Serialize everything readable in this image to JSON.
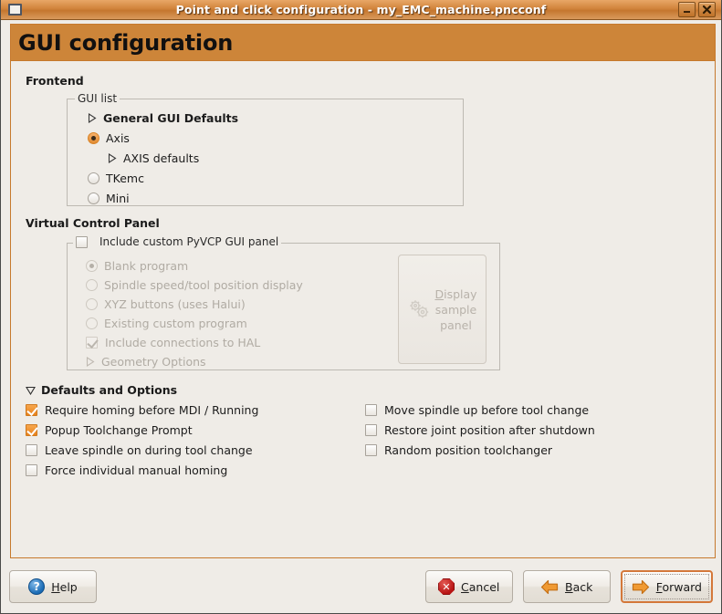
{
  "window": {
    "title": "Point and click configuration - my_EMC_machine.pncconf",
    "icon": "window-icon",
    "minimize_label": "_",
    "close_label": "x"
  },
  "banner": {
    "title": "GUI configuration"
  },
  "frontend": {
    "section_label": "Frontend",
    "group_title": "GUI list",
    "items": [
      {
        "label": "General GUI Defaults",
        "type": "expander",
        "bold": true,
        "indent": 0,
        "expanded": false
      },
      {
        "label": "Axis",
        "type": "radio",
        "selected": true,
        "indent": 0
      },
      {
        "label": "AXIS defaults",
        "type": "expander",
        "bold": false,
        "indent": 1,
        "expanded": false
      },
      {
        "label": "TKemc",
        "type": "radio",
        "selected": false,
        "indent": 0
      },
      {
        "label": "Mini",
        "type": "radio",
        "selected": false,
        "indent": 0
      }
    ]
  },
  "virtual_control_panel": {
    "section_label": "Virtual Control Panel",
    "include_panel": {
      "label": "Include custom PyVCP GUI panel",
      "checked": false
    },
    "options": [
      {
        "label": "Blank program",
        "type": "radio",
        "selected": true,
        "disabled": true
      },
      {
        "label": "Spindle speed/tool position display",
        "type": "radio",
        "selected": false,
        "disabled": true
      },
      {
        "label": "XYZ buttons (uses Halui)",
        "type": "radio",
        "selected": false,
        "disabled": true
      },
      {
        "label": "Existing custom program",
        "type": "radio",
        "selected": false,
        "disabled": true
      },
      {
        "label": "Include connections to HAL",
        "type": "checkbox",
        "selected": true,
        "disabled": true
      },
      {
        "label": "Geometry Options",
        "type": "expander",
        "selected": false,
        "disabled": true
      }
    ],
    "sample_button": {
      "line1": "Display",
      "line2": "sample",
      "line3": "panel",
      "accel": "D",
      "icon": "gears-icon",
      "disabled": true
    }
  },
  "defaults_and_options": {
    "header": "Defaults and Options",
    "expanded": true,
    "left_column": [
      {
        "label": "Require homing before MDI / Running",
        "checked": true
      },
      {
        "label": "Popup Toolchange Prompt",
        "checked": true
      },
      {
        "label": "Leave spindle on during tool change",
        "checked": false
      },
      {
        "label": "Force individual manual homing",
        "checked": false
      }
    ],
    "right_column": [
      {
        "label": "Move spindle up before tool change",
        "checked": false
      },
      {
        "label": "Restore joint position after shutdown",
        "checked": false
      },
      {
        "label": "Random position toolchanger",
        "checked": false
      }
    ]
  },
  "actions": {
    "help": {
      "label": "Help",
      "accel": "H",
      "icon": "help-icon"
    },
    "cancel": {
      "label": "Cancel",
      "accel": "C",
      "icon": "cancel-icon"
    },
    "back": {
      "label": "Back",
      "accel": "B",
      "icon": "arrow-left-icon"
    },
    "forward": {
      "label": "Forward",
      "accel": "F",
      "icon": "arrow-right-icon",
      "focused": true
    }
  },
  "colors": {
    "accent_orange": "#cd8539",
    "titlebar_orange": "#d1843c",
    "check_orange": "#e8821c",
    "background": "#efece7",
    "cancel_red": "#b81414",
    "help_blue": "#1a6bb5"
  }
}
